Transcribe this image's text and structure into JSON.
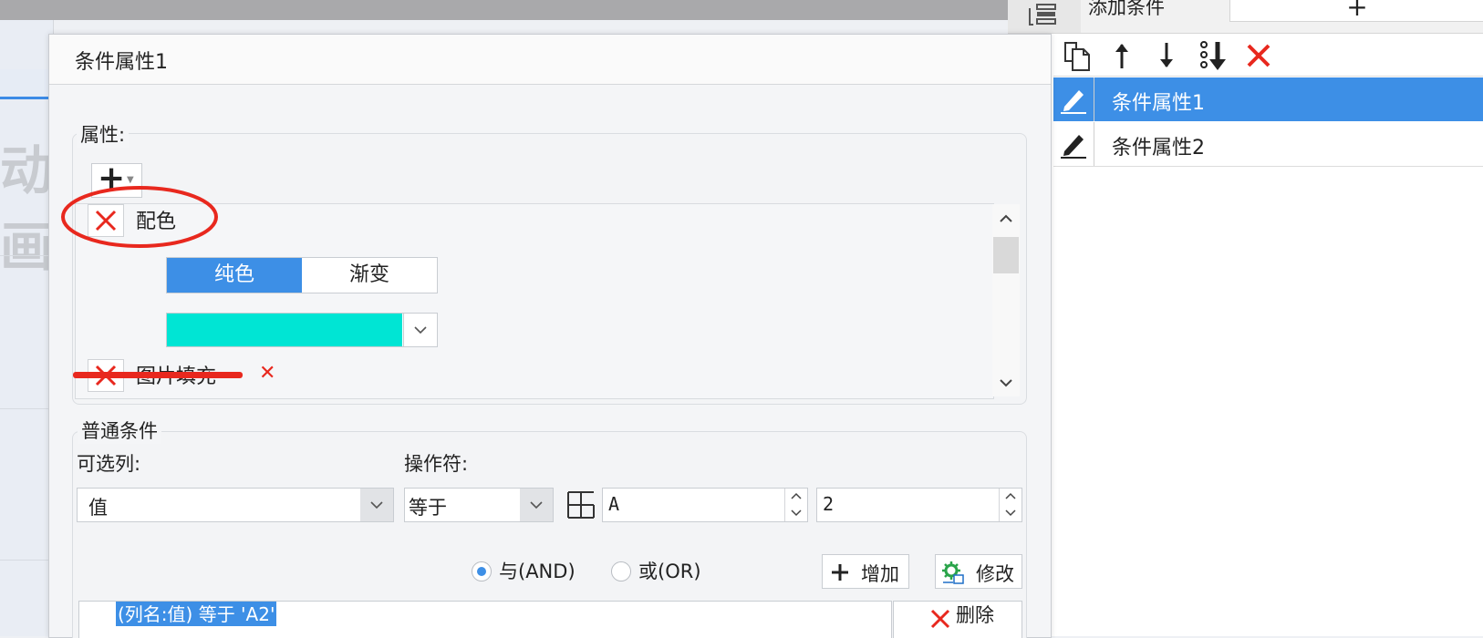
{
  "background": {
    "partial_text": "动画"
  },
  "right_panel": {
    "add_condition_label": "添加条件",
    "add_condition_button": "+",
    "toolbar": {
      "copy": "copy-icon",
      "move_up": "arrow-up-icon",
      "move_down": "arrow-down-icon",
      "move_bottom": "move-to-bottom-icon",
      "delete": "delete-icon"
    },
    "conditions": [
      {
        "label": "条件属性1",
        "selected": true
      },
      {
        "label": "条件属性2",
        "selected": false
      }
    ]
  },
  "dialog": {
    "title": "条件属性1",
    "properties": {
      "legend": "属性:",
      "add_button": "+",
      "items": [
        {
          "label": "配色"
        },
        {
          "label": "图片填充"
        }
      ],
      "fill_modes": {
        "solid": "纯色",
        "gradient": "渐变",
        "selected": "solid"
      },
      "color_value": "#00e5d4"
    },
    "normal_conditions": {
      "legend": "普通条件",
      "column_label": "可选列:",
      "column_value": "值",
      "operator_label": "操作符:",
      "operator_value": "等于",
      "value_1": "A",
      "value_2": "2",
      "logic": {
        "and_label": "与(AND)",
        "or_label": "或(OR)",
        "selected": "and"
      },
      "add_button": "增加",
      "modify_button": "修改",
      "delete_button": "删除",
      "expression": "(列名:值) 等于 'A2'"
    }
  },
  "colors": {
    "accent": "#3d8fe6",
    "delete_red": "#e8281e",
    "annotation_red": "#e8281e"
  }
}
